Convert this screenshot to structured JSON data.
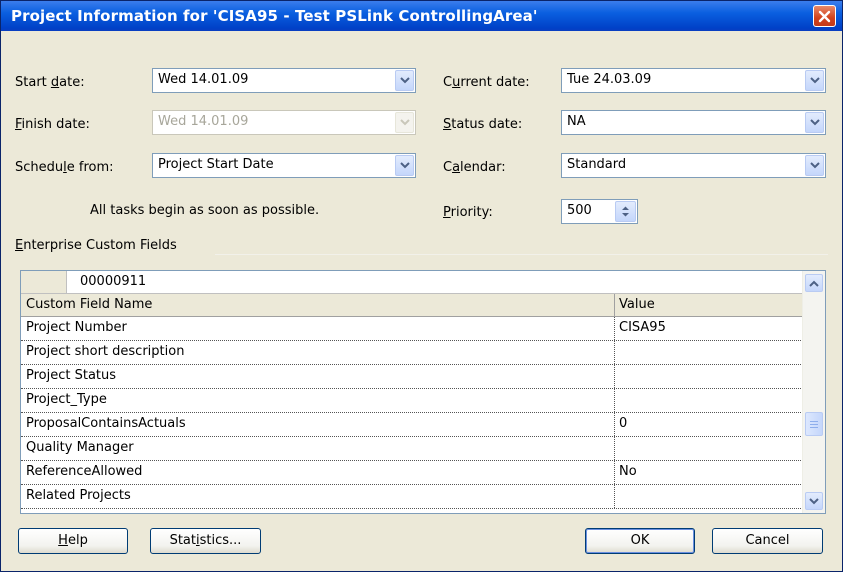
{
  "window": {
    "title": "Project Information for 'CISA95 - Test PSLink ControllingArea'",
    "colors": {
      "titlebar": "#0a5fe0",
      "face": "#ece9d8",
      "close": "#d2421c"
    }
  },
  "form": {
    "start_date": {
      "label_pre": "Start ",
      "label_key": "d",
      "label_post": "ate:",
      "value": "Wed 14.01.09"
    },
    "finish_date": {
      "label_pre": "",
      "label_key": "F",
      "label_post": "inish date:",
      "value": "Wed 14.01.09"
    },
    "schedule_from": {
      "label_pre": "Schedu",
      "label_key": "l",
      "label_post": "e from:",
      "value": "Project Start Date"
    },
    "note": "All tasks begin as soon as possible.",
    "current_date": {
      "label_pre": "C",
      "label_key": "u",
      "label_post": "rrent date:",
      "value": "Tue 24.03.09"
    },
    "status_date": {
      "label_pre": "",
      "label_key": "S",
      "label_post": "tatus date:",
      "value": "NA"
    },
    "calendar": {
      "label_pre": "C",
      "label_key": "a",
      "label_post": "lendar:",
      "value": "Standard"
    },
    "priority": {
      "label_pre": "",
      "label_key": "P",
      "label_post": "riority:",
      "value": "500"
    }
  },
  "custom_fields": {
    "label_pre": "",
    "label_key": "E",
    "label_post": "nterprise Custom Fields",
    "edit_value": "00000911",
    "columns": [
      "Custom Field Name",
      "Value"
    ],
    "rows": [
      {
        "name": "Project Number",
        "value": "CISA95"
      },
      {
        "name": "Project short description",
        "value": ""
      },
      {
        "name": "Project Status",
        "value": ""
      },
      {
        "name": "Project_Type",
        "value": ""
      },
      {
        "name": "ProposalContainsActuals",
        "value": "0"
      },
      {
        "name": "Quality Manager",
        "value": ""
      },
      {
        "name": "ReferenceAllowed",
        "value": "No"
      },
      {
        "name": "Related Projects",
        "value": ""
      }
    ]
  },
  "buttons": {
    "help": {
      "pre": "",
      "key": "H",
      "post": "elp"
    },
    "statistics": {
      "pre": "Stat",
      "key": "i",
      "post": "stics..."
    },
    "ok": "OK",
    "cancel": "Cancel"
  }
}
